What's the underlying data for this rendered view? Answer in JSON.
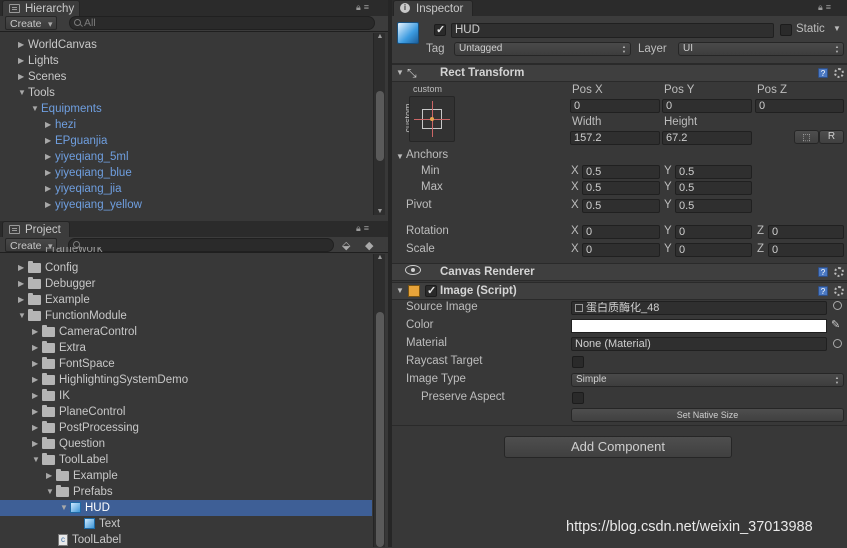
{
  "hierarchy": {
    "tab": "Hierarchy",
    "create": "Create",
    "search_placeholder": "All",
    "items": [
      "WorldCanvas",
      "Lights",
      "Scenes",
      "Tools",
      "Equipments",
      "hezi",
      "EPguanjia",
      "yiyeqiang_5ml",
      "yiyeqiang_blue",
      "yiyeqiang_jia",
      "yiyeqiang_yellow"
    ]
  },
  "project": {
    "tab": "Project",
    "create": "Create",
    "partial_top": "Framework",
    "items": [
      "Config",
      "Debugger",
      "Example",
      "FunctionModule",
      "CameraControl",
      "Extra",
      "FontSpace",
      "HighlightingSystemDemo",
      "IK",
      "PlaneControl",
      "PostProcessing",
      "Question",
      "ToolLabel",
      "Example",
      "Prefabs",
      "HUD",
      "Text",
      "ToolLabel"
    ]
  },
  "inspector": {
    "tab": "Inspector",
    "object_name": "HUD",
    "static_label": "Static",
    "tag_label": "Tag",
    "tag_value": "Untagged",
    "layer_label": "Layer",
    "layer_value": "UI",
    "rect_transform": {
      "title": "Rect Transform",
      "anchor_preset_top": "custom",
      "anchor_preset_side": "custom",
      "pos_x_label": "Pos X",
      "pos_y_label": "Pos Y",
      "pos_z_label": "Pos Z",
      "pos_x": "0",
      "pos_y": "0",
      "pos_z": "0",
      "width_label": "Width",
      "height_label": "Height",
      "width": "157.2",
      "height": "67.2",
      "r_button": "R",
      "anchors_label": "Anchors",
      "min_label": "Min",
      "max_label": "Max",
      "min_x": "0.5",
      "min_y": "0.5",
      "max_x": "0.5",
      "max_y": "0.5",
      "pivot_label": "Pivot",
      "pivot_x": "0.5",
      "pivot_y": "0.5",
      "rotation_label": "Rotation",
      "rot_x": "0",
      "rot_y": "0",
      "rot_z": "0",
      "scale_label": "Scale",
      "scale_x": "0",
      "scale_y": "0",
      "scale_z": "0",
      "axis_x": "X",
      "axis_y": "Y",
      "axis_z": "Z"
    },
    "canvas_renderer": {
      "title": "Canvas Renderer"
    },
    "image": {
      "title": "Image (Script)",
      "source_image_label": "Source Image",
      "source_image_value": "蛋白质酶化_48",
      "color_label": "Color",
      "color_value": "#ffffff",
      "material_label": "Material",
      "material_value": "None (Material)",
      "raycast_label": "Raycast Target",
      "image_type_label": "Image Type",
      "image_type_value": "Simple",
      "preserve_label": "Preserve Aspect",
      "native_size_button": "Set Native Size"
    },
    "add_component": "Add Component"
  },
  "watermark": "https://blog.csdn.net/weixin_37013988"
}
